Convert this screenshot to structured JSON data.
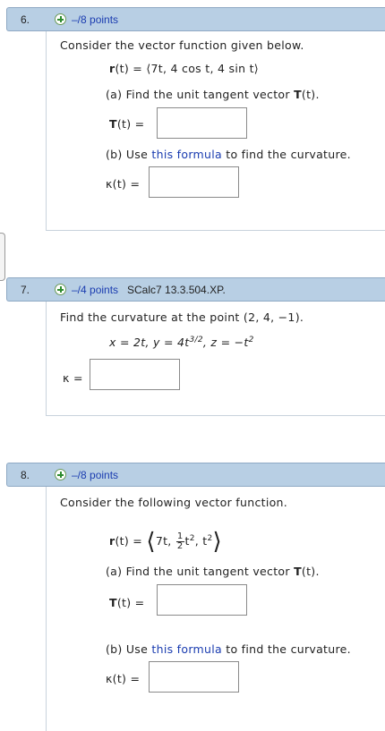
{
  "questions": [
    {
      "number": "6.",
      "points": "–/8 points",
      "source": "",
      "prompt": "Consider the vector function given below.",
      "eq_lhs": "r",
      "eq_rhs": "(t) = ⟨7t, 4 cos t, 4 sin t⟩",
      "part_a": "(a) Find the unit tangent vector ",
      "part_a_T": "T",
      "part_a_end": "(t).",
      "answer_a_label": "(t) =",
      "answer_a_T": "T",
      "part_b_pre": "(b) Use ",
      "part_b_link": "this formula",
      "part_b_post": " to find the curvature.",
      "answer_b_label": "κ(t) ="
    },
    {
      "number": "7.",
      "points": "–/4 points",
      "source": "SCalc7 13.3.504.XP.",
      "prompt": "Find the curvature at the point (2, 4, −1).",
      "eq": "x = 2t, y = 4t",
      "eq_exp": "3/2",
      "eq_tail": ", z = −t",
      "eq_tail_exp": "2",
      "answer_label": "κ ="
    },
    {
      "number": "8.",
      "points": "–/8 points",
      "source": "",
      "prompt": "Consider the following vector function.",
      "eq_lhs": "r",
      "eq_mid": "(t) =",
      "eq_a": "7t,",
      "frac_n": "1",
      "frac_d": "2",
      "eq_b": "t",
      "eq_b_exp": "2",
      "eq_c": ", t",
      "eq_c_exp": "2",
      "part_a": "(a) Find the unit tangent vector ",
      "part_a_T": "T",
      "part_a_end": "(t).",
      "answer_a_T": "T",
      "answer_a_label": "(t) =",
      "part_b_pre": "(b) Use ",
      "part_b_link": "this formula",
      "part_b_post": " to find the curvature.",
      "answer_b_label": "κ(t) ="
    }
  ]
}
